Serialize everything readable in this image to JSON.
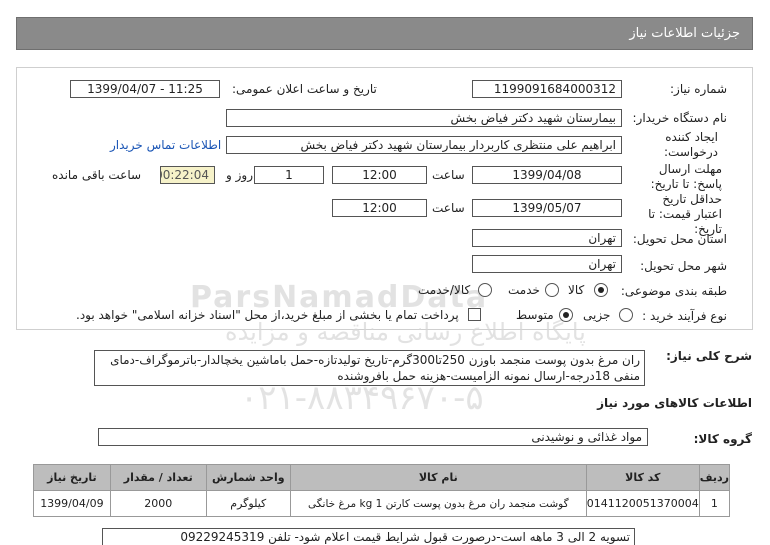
{
  "header": {
    "title": "جزئیات اطلاعات نیاز"
  },
  "form": {
    "need_number_label": "شماره نیاز:",
    "need_number": "1199091684000312",
    "announce_label": "تاریخ و ساعت اعلان عمومی:",
    "announce_value": "1399/04/07 - 11:25",
    "buyer_label": "نام دستگاه خریدار:",
    "buyer_value": "بیمارستان شهید دکتر فیاض بخش",
    "creator_label": "ایجاد کننده درخواست:",
    "creator_value": "ابراهیم علی منتظری کاربردار بیمارستان شهید دکتر فیاض بخش",
    "contact_link": "اطلاعات تماس خریدار",
    "reply_deadline_label": "مهلت ارسال پاسخ: تا تاریخ:",
    "reply_date": "1399/04/08",
    "time_label": "ساعت",
    "reply_time": "12:00",
    "days_value": "1",
    "days_label": "روز و",
    "remaining_time": "00:22:04",
    "remaining_label": "ساعت باقی مانده",
    "validity_label": "حداقل تاریخ اعتبار قیمت: تا تاریخ:",
    "validity_date": "1399/05/07",
    "validity_time": "12:00",
    "province_label": "استان محل تحویل:",
    "province_value": "تهران",
    "city_label": "شهر محل تحویل:",
    "city_value": "تهران",
    "category_label": "طبقه بندی موضوعی:",
    "category_options": [
      "کالا",
      "خدمت",
      "کالا/خدمت"
    ],
    "category_selected": "کالا",
    "process_label": "نوع فرآیند خرید :",
    "process_options": [
      "جزیی",
      "متوسط"
    ],
    "process_selected": "متوسط",
    "payment_note": "پرداخت تمام یا بخشی از مبلغ خرید،از محل \"اسناد خزانه اسلامی\" خواهد بود."
  },
  "watermark": {
    "brand": "ParsNamadData",
    "line2": "پایگاه اطلاع رسانی مناقصه و مزایده",
    "phone": "۰۲۱-۸۸۳۴۹۶۷۰-۵"
  },
  "summary": {
    "label": "شرح کلی نیاز:",
    "text": "ران مرغ بدون پوست منجمد باوزن 250تا300گرم-تاریخ تولیدتازه-حمل باماشین یخچالدار-باترموگراف-دمای منفی 18درجه-ارسال نمونه الزامیست-هزینه حمل بافروشنده"
  },
  "goods_section": {
    "title": "اطلاعات کالاهای مورد نیاز",
    "group_label": "گروه کالا:",
    "group_value": "مواد غذائی و نوشیدنی"
  },
  "table": {
    "headers": [
      "ردیف",
      "کد کالا",
      "نام کالا",
      "واحد شمارش",
      "تعداد / مقدار",
      "تاریخ نیاز"
    ],
    "rows": [
      [
        "1",
        "0141120051370004",
        "گوشت منجمد ران مرغ بدون پوست کارتن 1 kg مرغ خانگی",
        "کیلوگرم",
        "2000",
        "1399/04/09"
      ]
    ]
  },
  "note": {
    "text": "تسویه 2 الی 3 ماهه است-درصورت قبول شرایط قیمت اعلام شود- تلفن 09229245319"
  }
}
